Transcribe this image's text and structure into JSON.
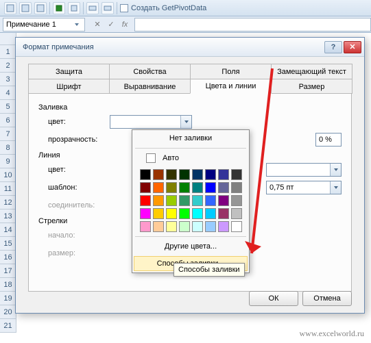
{
  "ribbon": {
    "getpivot_label": "Создать GetPivotData"
  },
  "formula": {
    "name_box": "Примечание 1",
    "fx_label": "fx"
  },
  "rows": [
    "1",
    "2",
    "3",
    "4",
    "5",
    "6",
    "7",
    "8",
    "9",
    "10",
    "11",
    "12",
    "13",
    "14",
    "15",
    "16",
    "17",
    "18",
    "19",
    "20",
    "21"
  ],
  "dialog": {
    "title": "Формат примечания",
    "help": "?",
    "close": "✕",
    "tabs_row1": [
      "Защита",
      "Свойства",
      "Поля",
      "Замещающий текст"
    ],
    "tabs_row2": [
      "Шрифт",
      "Выравнивание",
      "Цвета и линии",
      "Размер"
    ],
    "active_tab": "Цвета и линии",
    "group_fill": "Заливка",
    "lbl_color": "цвет:",
    "lbl_opacity": "прозрачность:",
    "pct_value": "0 %",
    "group_line": "Линия",
    "lbl_line_color": "цвет:",
    "lbl_template": "шаблон:",
    "lbl_connector": "соединитель:",
    "thickness_value": "0,75 пт",
    "group_arrows": "Стрелки",
    "lbl_start": "начало:",
    "lbl_size": "размер:",
    "ok": "ОК",
    "cancel": "Отмена"
  },
  "popup": {
    "no_fill": "Нет заливки",
    "auto": "Авто",
    "other_colors": "Другие цвета...",
    "fill_effects": "Способы заливки...",
    "swatches": [
      "#000000",
      "#993300",
      "#333300",
      "#003300",
      "#003366",
      "#000080",
      "#333399",
      "#333333",
      "#800000",
      "#ff6600",
      "#808000",
      "#008000",
      "#008080",
      "#0000ff",
      "#666699",
      "#808080",
      "#ff0000",
      "#ff9900",
      "#99cc00",
      "#339966",
      "#33cccc",
      "#3366ff",
      "#800080",
      "#969696",
      "#ff00ff",
      "#ffcc00",
      "#ffff00",
      "#00ff00",
      "#00ffff",
      "#00ccff",
      "#993366",
      "#c0c0c0",
      "#ff99cc",
      "#ffcc99",
      "#ffff99",
      "#ccffcc",
      "#ccffff",
      "#99ccff",
      "#cc99ff",
      "#ffffff"
    ]
  },
  "tooltip": "Способы заливки",
  "watermark": "www.excelworld.ru"
}
